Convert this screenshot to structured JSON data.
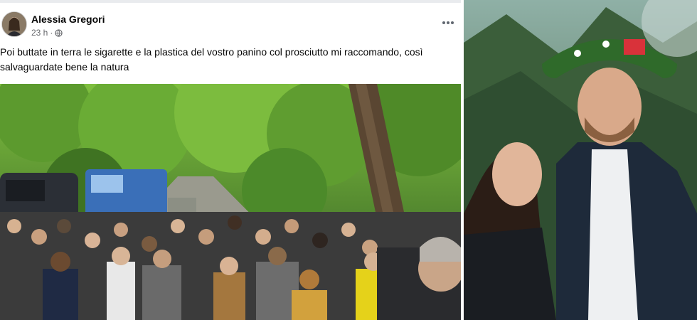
{
  "post": {
    "author": "Alessia Gregori",
    "time": "23 h",
    "separator": "·",
    "more_icon": "more-options-icon",
    "text_line1": "Poi buttate in terra le sigarette e la plastica del vostro panino col prosciutto mi raccomando, così",
    "text_line2": "salvaguardate bene la natura"
  },
  "colors": {
    "name": "#050505",
    "meta": "#65676b",
    "forest": "#4f8a35"
  }
}
